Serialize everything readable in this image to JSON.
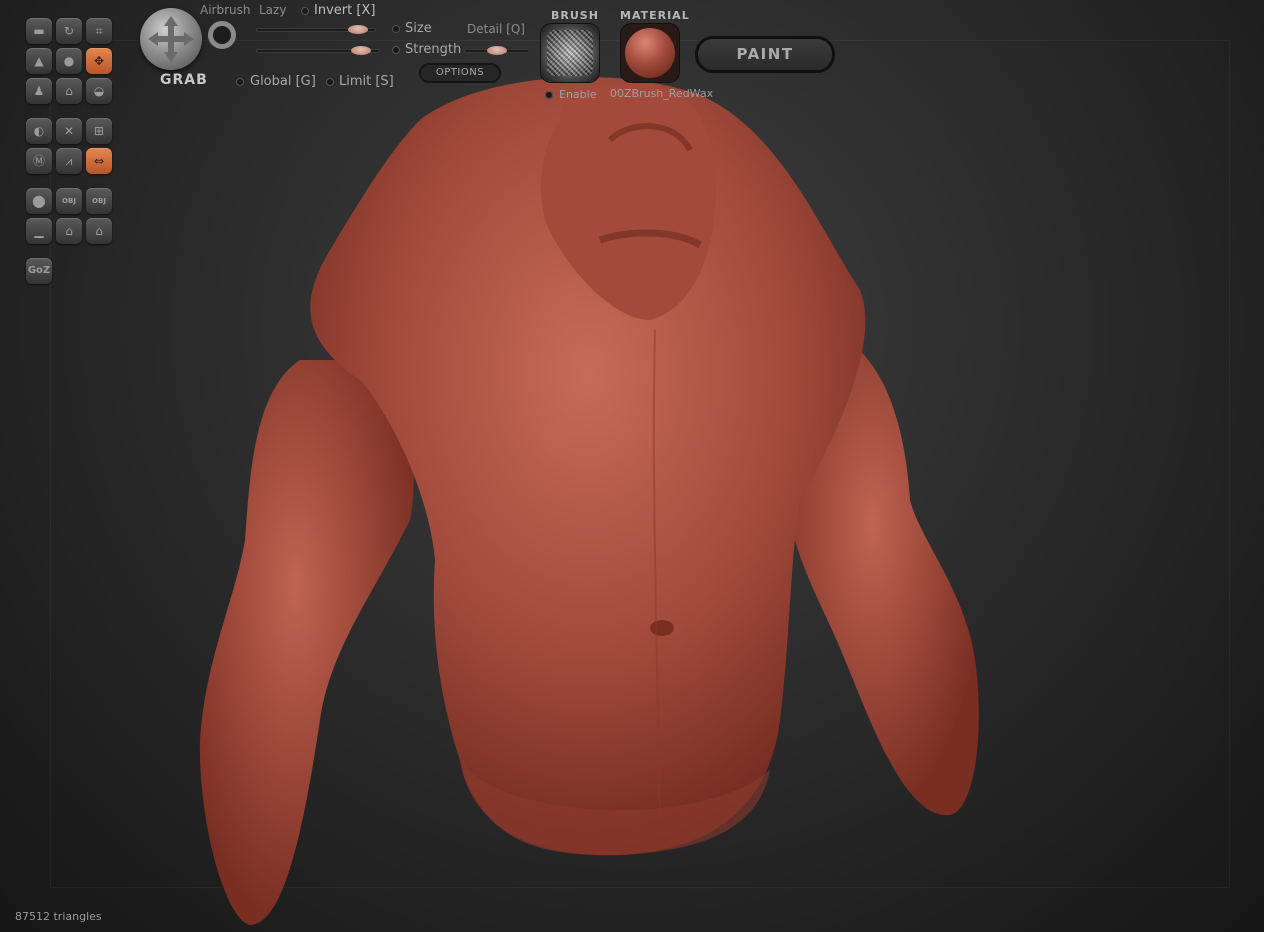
{
  "toolbar": {
    "tool_name": "GRAB",
    "airbrush_label": "Airbrush",
    "lazy_label": "Lazy",
    "invert_label": "Invert [X]",
    "size_label": "Size",
    "detail_label": "Detail [Q]",
    "strength_label": "Strength",
    "global_label": "Global [G]",
    "limit_label": "Limit [S]",
    "options_label": "OPTIONS",
    "brush_title": "BRUSH",
    "material_title": "MATERIAL",
    "enable_label": "Enable",
    "material_name": "00ZBrush_RedWax",
    "paint_label": "PAINT",
    "size_value": 0.85,
    "strength_value": 0.85,
    "detail_value": 0.5
  },
  "tool_palette": {
    "icons": [
      "standard-brush-icon",
      "rotate-icon",
      "crop-icon",
      "inflate-brush-icon",
      "clay-brush-icon",
      "grab-move-icon",
      "pinch-brush-icon",
      "flatten-brush-icon",
      "smooth-brush-icon",
      "symmetry-icon",
      "mask-icon",
      "grid-icon",
      "m-icon",
      "zigzag-icon",
      "mirror-arrows-icon",
      "sphere-icon",
      "import-obj-icon",
      "export-obj-icon",
      "plane-icon",
      "save-icon",
      "load-icon",
      "goz-icon"
    ],
    "active": [
      "grab-move-icon",
      "mirror-arrows-icon"
    ],
    "obj_label": "OBJ",
    "goz_label": "GoZ"
  },
  "status": {
    "triangles": "87512 triangles"
  },
  "colors": {
    "accent": "#d9733f",
    "model": "#a14a3b",
    "background": "#2c2c2c"
  }
}
